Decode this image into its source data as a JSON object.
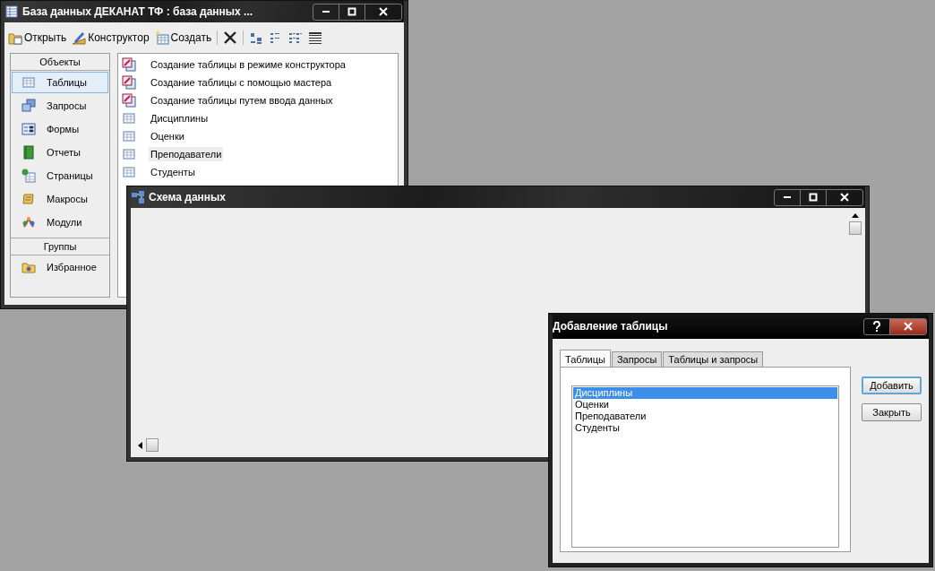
{
  "db_window": {
    "title": "База данных ДЕКАНАТ ТФ : база данных ...",
    "toolbar": [
      {
        "kind": "open",
        "label": "Открыть"
      },
      {
        "kind": "design",
        "label": "Конструктор"
      },
      {
        "kind": "new",
        "label": "Создать"
      },
      {
        "kind": "delete"
      },
      {
        "kind": "large-icons"
      },
      {
        "kind": "small-icons"
      },
      {
        "kind": "list"
      },
      {
        "kind": "details"
      }
    ],
    "objects_header": "Объекты",
    "objects": [
      {
        "kind": "tables",
        "label": "Таблицы",
        "selected": true
      },
      {
        "kind": "queries",
        "label": "Запросы",
        "selected": false
      },
      {
        "kind": "forms",
        "label": "Формы",
        "selected": false
      },
      {
        "kind": "reports",
        "label": "Отчеты",
        "selected": false
      },
      {
        "kind": "pages",
        "label": "Страницы",
        "selected": false
      },
      {
        "kind": "macros",
        "label": "Макросы",
        "selected": false
      },
      {
        "kind": "modules",
        "label": "Модули",
        "selected": false
      }
    ],
    "groups_header": "Группы",
    "groups": [
      {
        "kind": "favorites",
        "label": "Избранное",
        "selected": false
      }
    ],
    "items": [
      {
        "kind": "wizard",
        "label": "Создание таблицы в режиме конструктора",
        "selected": false
      },
      {
        "kind": "wizard",
        "label": "Создание таблицы с помощью мастера",
        "selected": false
      },
      {
        "kind": "wizard",
        "label": "Создание таблицы путем ввода данных",
        "selected": false
      },
      {
        "kind": "table",
        "label": "Дисциплины",
        "selected": false
      },
      {
        "kind": "table",
        "label": "Оценки",
        "selected": false
      },
      {
        "kind": "table",
        "label": "Преподаватели",
        "selected": true
      },
      {
        "kind": "table",
        "label": "Студенты",
        "selected": false
      }
    ]
  },
  "schema_window": {
    "title": "Схема данных"
  },
  "dialog": {
    "title": "Добавление таблицы",
    "tabs": [
      {
        "label": "Таблицы",
        "selected": true
      },
      {
        "label": "Запросы",
        "selected": false
      },
      {
        "label": "Таблицы и запросы",
        "selected": false
      }
    ],
    "items": [
      {
        "label": "Дисциплины",
        "selected": true
      },
      {
        "label": "Оценки",
        "selected": false
      },
      {
        "label": "Преподаватели",
        "selected": false
      },
      {
        "label": "Студенты",
        "selected": false
      }
    ],
    "buttons": [
      {
        "label": "Добавить",
        "default": true
      },
      {
        "label": "Закрыть",
        "default": false
      }
    ]
  }
}
